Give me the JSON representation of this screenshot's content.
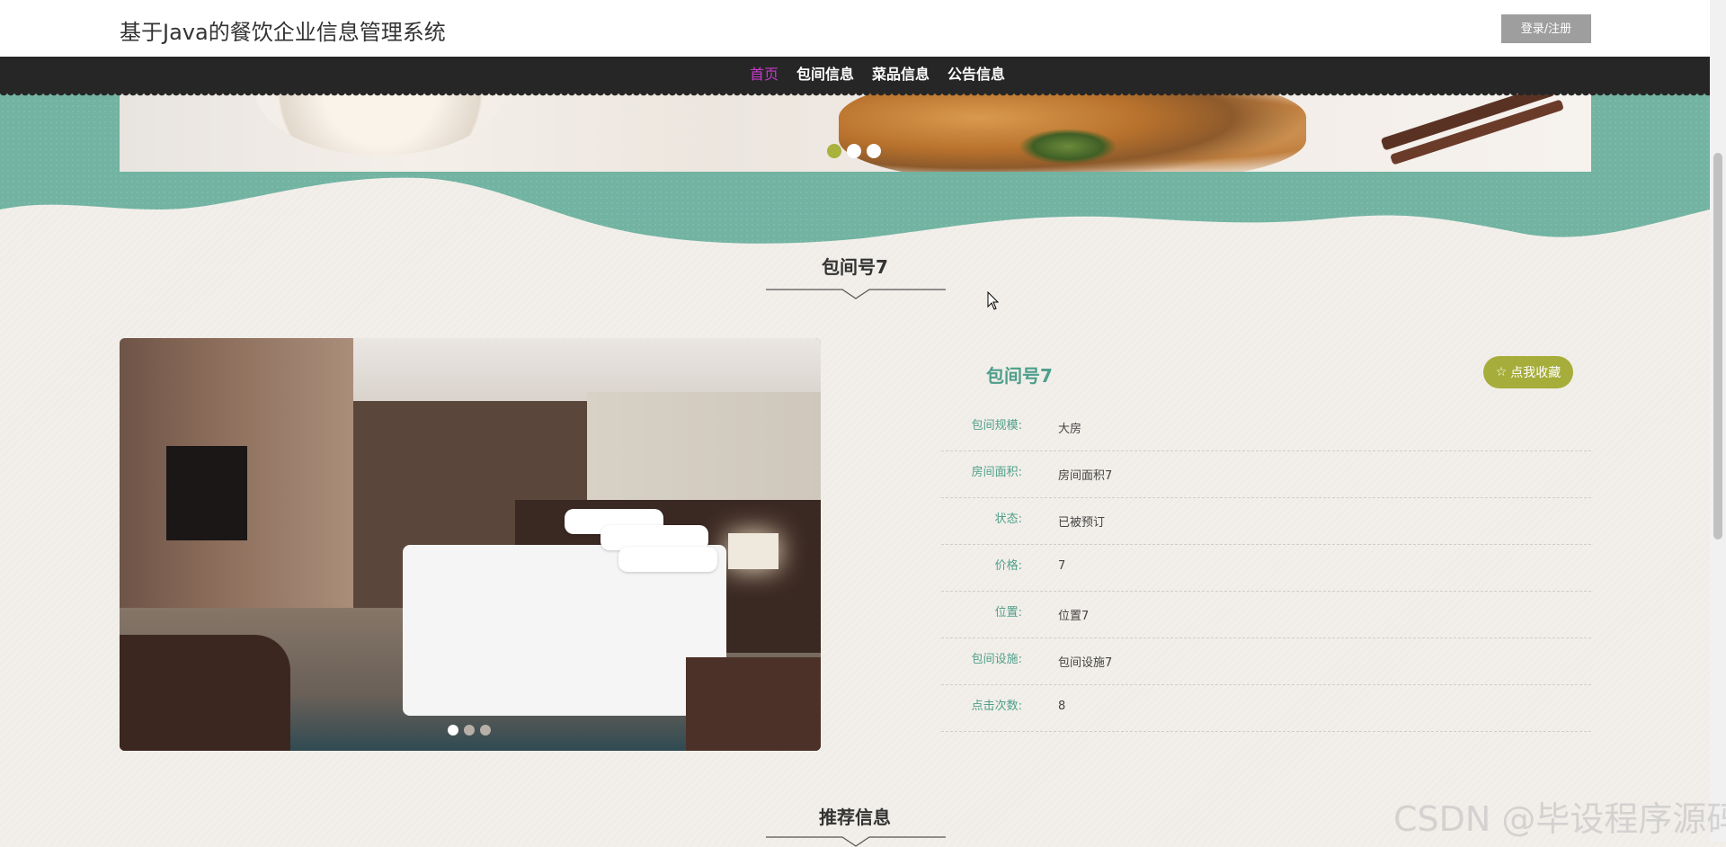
{
  "header": {
    "site_title": "基于Java的餐饮企业信息管理系统",
    "login_label": "登录/注册"
  },
  "nav": {
    "items": [
      {
        "label": "首页",
        "active": true
      },
      {
        "label": "包间信息",
        "active": false
      },
      {
        "label": "菜品信息",
        "active": false
      },
      {
        "label": "公告信息",
        "active": false
      }
    ]
  },
  "banner": {
    "slide_count": 3,
    "active_slide": 1
  },
  "section": {
    "title": "包间号7"
  },
  "gallery": {
    "slide_count": 3,
    "active_slide": 1
  },
  "detail": {
    "title": "包间号7",
    "favorite_label": "点我收藏",
    "favorite_icon": "star-outline-icon",
    "fields": [
      {
        "label": "包间规模:",
        "value": "大房"
      },
      {
        "label": "房间面积:",
        "value": "房间面积7"
      },
      {
        "label": "状态:",
        "value": "已被预订"
      },
      {
        "label": "价格:",
        "value": "7"
      },
      {
        "label": "位置:",
        "value": "位置7"
      },
      {
        "label": "包间设施:",
        "value": "包间设施7"
      },
      {
        "label": "点击次数:",
        "value": "8"
      }
    ]
  },
  "recommend": {
    "title": "推荐信息"
  },
  "watermark": "CSDN @毕设程序源码",
  "colors": {
    "accent_green": "#4e9f8b",
    "wave_teal": "#72b3a2",
    "fav_button": "#a6ad3a",
    "nav_active": "#c63bc9",
    "nav_bg": "#262626"
  }
}
